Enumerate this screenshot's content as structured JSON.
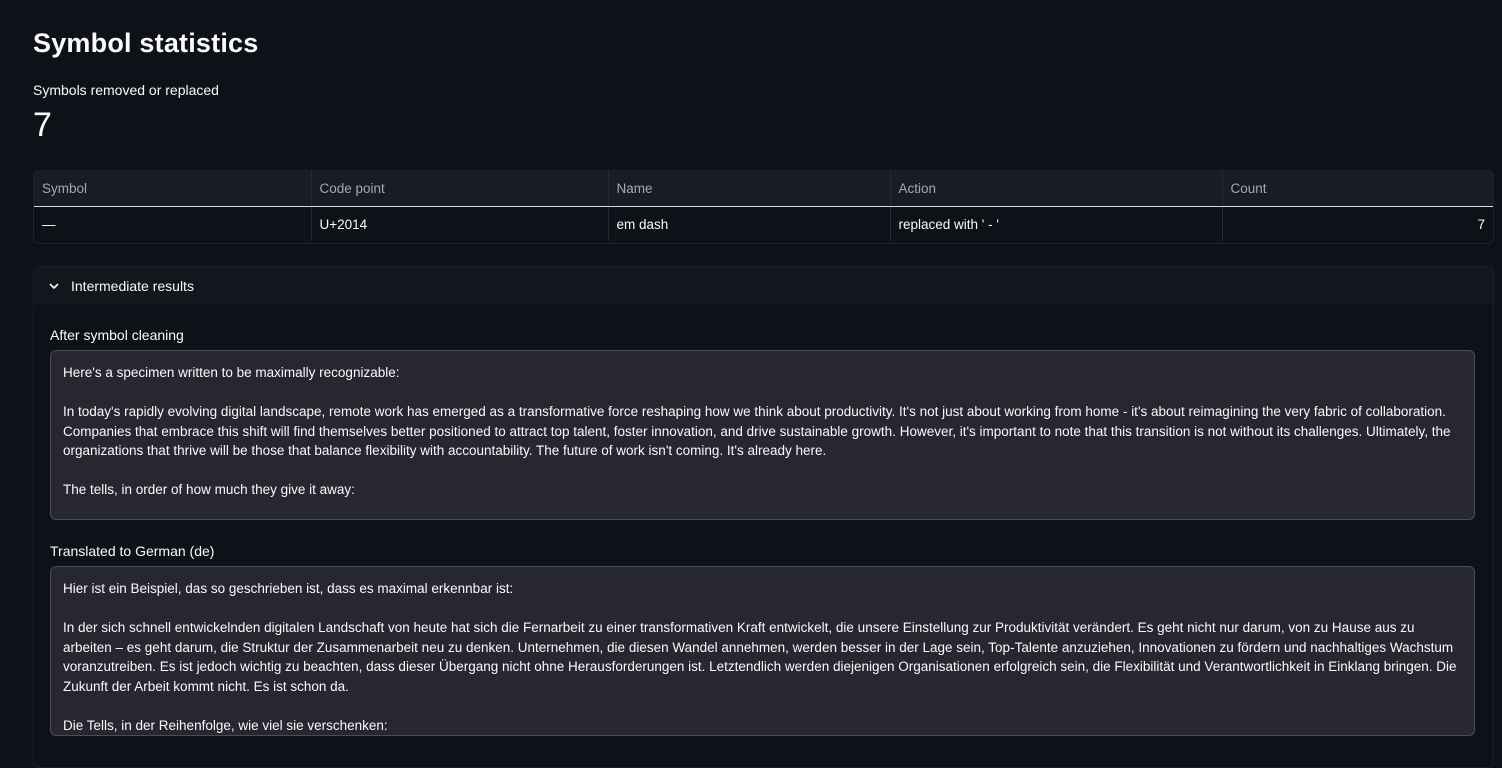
{
  "page": {
    "title": "Symbol statistics"
  },
  "metric": {
    "label": "Symbols removed or replaced",
    "value": "7"
  },
  "table": {
    "columns": [
      "Symbol",
      "Code point",
      "Name",
      "Action",
      "Count"
    ],
    "rows": [
      [
        "—",
        "U+2014",
        "em dash",
        "replaced with ' - '",
        "7"
      ]
    ]
  },
  "expander": {
    "label": "Intermediate results",
    "icon": "chevron-down-icon",
    "expanded": true,
    "sections": [
      {
        "label": "After symbol cleaning",
        "text": "Here's a specimen written to be maximally recognizable:\n\nIn today's rapidly evolving digital landscape, remote work has emerged as a transformative force reshaping how we think about productivity. It's not just about working from home - it's about reimagining the very fabric of collaboration. Companies that embrace this shift will find themselves better positioned to attract top talent, foster innovation, and drive sustainable growth. However, it's important to note that this transition is not without its challenges. Ultimately, the organizations that thrive will be those that balance flexibility with accountability. The future of work isn't coming. It's already here.\n\nThe tells, in order of how much they give it away:"
      },
      {
        "label": "Translated to German (de)",
        "text": "Hier ist ein Beispiel, das so geschrieben ist, dass es maximal erkennbar ist:\n\nIn der sich schnell entwickelnden digitalen Landschaft von heute hat sich die Fernarbeit zu einer transformativen Kraft entwickelt, die unsere Einstellung zur Produktivität verändert. Es geht nicht nur darum, von zu Hause aus zu arbeiten – es geht darum, die Struktur der Zusammenarbeit neu zu denken. Unternehmen, die diesen Wandel annehmen, werden besser in der Lage sein, Top-Talente anzuziehen, Innovationen zu fördern und nachhaltiges Wachstum voranzutreiben. Es ist jedoch wichtig zu beachten, dass dieser Übergang nicht ohne Herausforderungen ist. Letztendlich werden diejenigen Organisationen erfolgreich sein, die Flexibilität und Verantwortlichkeit in Einklang bringen. Die Zukunft der Arbeit kommt nicht. Es ist schon da.\n\nDie Tells, in der Reihenfolge, wie viel sie verschenken:"
      }
    ]
  },
  "colors": {
    "background": "#0e1117",
    "text": "#fafafa",
    "header_text": "#a3a8b8",
    "textarea_bg": "#262730",
    "textarea_border": "#4a4c56"
  }
}
